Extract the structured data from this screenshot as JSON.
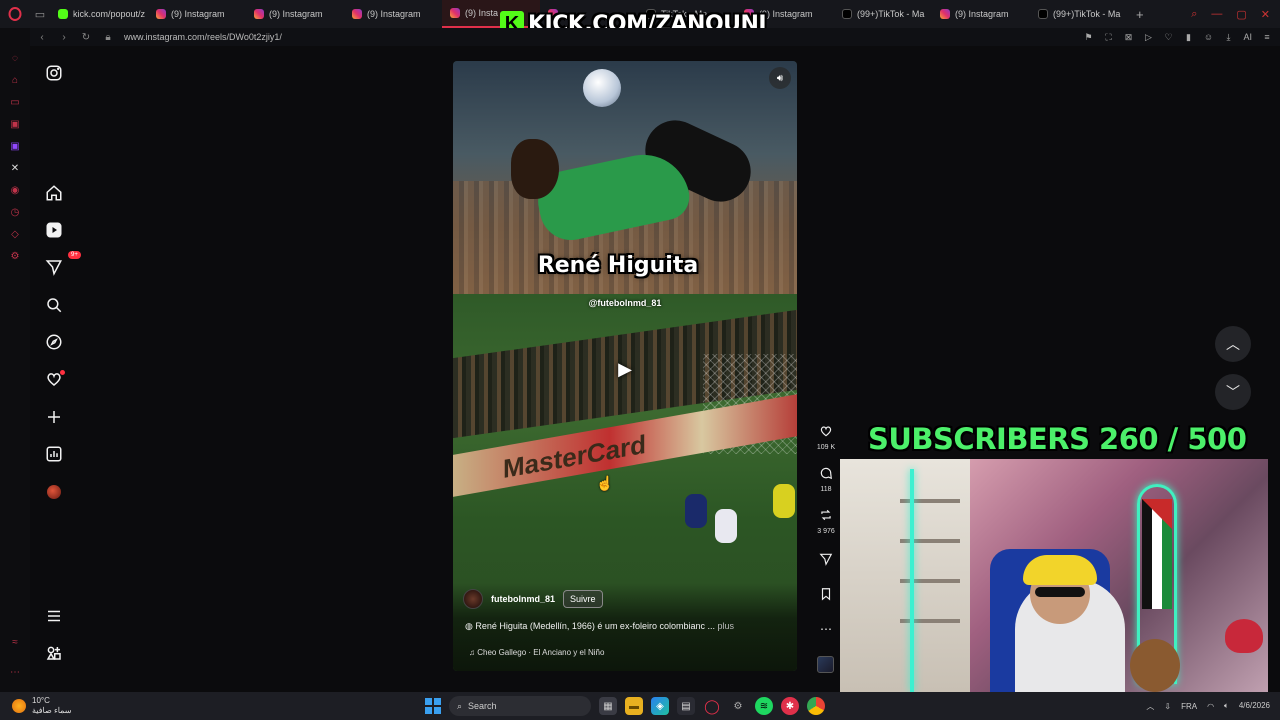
{
  "browser": {
    "tabs": [
      {
        "label": "kick.com/popout/z",
        "icon": "kick-icon"
      },
      {
        "label": "(9) Instagram",
        "icon": "instagram-icon"
      },
      {
        "label": "(9) Instagram",
        "icon": "instagram-icon"
      },
      {
        "label": "(9) Instagram",
        "icon": "instagram-icon"
      },
      {
        "label": "(9) Insta",
        "icon": "instagram-icon",
        "active": true
      },
      {
        "label": "",
        "icon": "instagram-icon"
      },
      {
        "label": "TikTok - Ma",
        "icon": "tiktok-icon"
      },
      {
        "label": "(9) Instagram",
        "icon": "instagram-icon"
      },
      {
        "label": "(99+)TikTok - Ma",
        "icon": "tiktok-icon"
      },
      {
        "label": "(9) Instagram",
        "icon": "instagram-icon"
      },
      {
        "label": "(99+)TikTok - Ma",
        "icon": "tiktok-icon"
      }
    ],
    "url": "www.instagram.com/reels/DWo0t2zjiy1/",
    "ai_label": "AI"
  },
  "overlay": {
    "kick_banner": "KICK.COM/ZANOUNI",
    "subscribers": "SUBSCRIBERS 260 / 500"
  },
  "reel": {
    "title": "René Higuita",
    "watermark": "@futebolnmd_81",
    "adboard_text": "MasterCard",
    "author": "futebolnmd_81",
    "follow_label": "Suivre",
    "caption": "René Higuita (Medellín, 1966) é um ex-foleiro colombianc ...",
    "more_label": "plus",
    "audio": "Cheo Gallego · El Anciano y el Niño"
  },
  "actions": {
    "likes": "109 K",
    "comments": "118",
    "reposts": "3 976"
  },
  "taskbar": {
    "temperature": "10°C",
    "weather_desc": "سماء صافية",
    "search_placeholder": "Search",
    "lang": "FRA",
    "date": "4/6/2026"
  },
  "colors": {
    "kick_green": "#53fc18",
    "subs_green": "#4cf06a",
    "opera_red": "#e0304a",
    "notif_red": "#ff3040"
  }
}
